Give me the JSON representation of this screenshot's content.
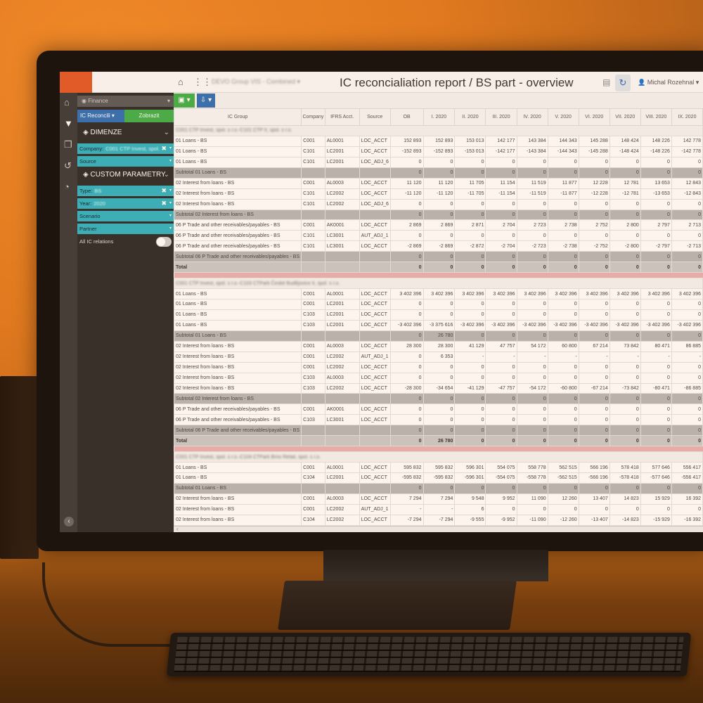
{
  "topbar": {
    "org_select": "DEVO Group VIS - Combined ▾",
    "title": "IC reconcialiation report / BS part - overview",
    "user": "Michal Rozehnal ▾",
    "home_icon": "home-icon",
    "apps_icon": "grid-icon"
  },
  "filters": {
    "module": "Finance",
    "report_button": "IC Reconcili ▾",
    "show_button": "Zobrazit",
    "dimenze_label": "DIMENZE",
    "company_label": "Company:",
    "company_value": "C001 CTP Invest, spol.",
    "source_label": "Source",
    "custom_label": "CUSTOM PARAMETRY",
    "type_label": "Type:",
    "type_value": "BS",
    "year_label": "Year:",
    "year_value": "2020",
    "scenario_label": "Scenario",
    "partner_label": "Partner",
    "all_ic_label": "All IC relations",
    "all_ic_on": false
  },
  "table": {
    "columns": [
      "IC Group",
      "Company",
      "IFRS Acct.",
      "Source",
      "OB",
      "I. 2020",
      "II. 2020",
      "III. 2020",
      "IV. 2020",
      "V. 2020",
      "VI. 2020",
      "VII. 2020",
      "VIII. 2020",
      "IX. 2020"
    ],
    "rows": [
      {
        "t": "grp",
        "label": "C001 CTP Invest, spol. s r.o.-C101 CTP II, spol. s r.o."
      },
      {
        "t": "d",
        "c": [
          "01 Loans - BS",
          "C001",
          "AL0001",
          "LOC_ACCT",
          "152 893",
          "152 893",
          "153 013",
          "142 177",
          "143 384",
          "144 343",
          "145 288",
          "148 424",
          "148 226",
          "142 778"
        ]
      },
      {
        "t": "d",
        "c": [
          "01 Loans - BS",
          "C101",
          "LC2001",
          "LOC_ACCT",
          "-152 893",
          "-152 893",
          "-153 013",
          "-142 177",
          "-143 384",
          "-144 343",
          "-145 288",
          "-148 424",
          "-148 226",
          "-142 778"
        ]
      },
      {
        "t": "d",
        "c": [
          "01 Loans - BS",
          "C101",
          "LC2001",
          "LOC_ADJ_6",
          "0",
          "0",
          "0",
          "0",
          "0",
          "0",
          "0",
          "0",
          "0",
          "0"
        ]
      },
      {
        "t": "sub",
        "c": [
          "Subtotal 01 Loans - BS",
          "",
          "",
          "",
          "0",
          "0",
          "0",
          "0",
          "0",
          "0",
          "0",
          "0",
          "0",
          "0"
        ]
      },
      {
        "t": "d",
        "c": [
          "02 Interest from loans - BS",
          "C001",
          "AL0003",
          "LOC_ACCT",
          "11 120",
          "11 120",
          "11 705",
          "11 154",
          "11 519",
          "11 877",
          "12 228",
          "12 781",
          "13 653",
          "12 843"
        ]
      },
      {
        "t": "d",
        "c": [
          "02 Interest from loans - BS",
          "C101",
          "LC2002",
          "LOC_ACCT",
          "-11 120",
          "-11 120",
          "-11 705",
          "-11 154",
          "-11 519",
          "-11 877",
          "-12 228",
          "-12 781",
          "-13 653",
          "-12 843"
        ]
      },
      {
        "t": "d",
        "c": [
          "02 Interest from loans - BS",
          "C101",
          "LC2002",
          "LOC_ADJ_6",
          "0",
          "0",
          "0",
          "0",
          "0",
          "0",
          "0",
          "0",
          "0",
          "0"
        ]
      },
      {
        "t": "sub",
        "c": [
          "Subtotal 02 Interest from loans - BS",
          "",
          "",
          "",
          "0",
          "0",
          "0",
          "0",
          "0",
          "0",
          "0",
          "0",
          "0",
          "0"
        ]
      },
      {
        "t": "d",
        "c": [
          "06 P Trade and other receivables/payables - BS",
          "C001",
          "AK0001",
          "LOC_ACCT",
          "2 869",
          "2 869",
          "2 871",
          "2 704",
          "2 723",
          "2 738",
          "2 752",
          "2 800",
          "2 797",
          "2 713"
        ]
      },
      {
        "t": "d",
        "c": [
          "06 P Trade and other receivables/payables - BS",
          "C101",
          "LC3001",
          "AUT_ADJ_1",
          "0",
          "0",
          "0",
          "0",
          "0",
          "0",
          "0",
          "0",
          "0",
          "0"
        ]
      },
      {
        "t": "d",
        "c": [
          "06 P Trade and other receivables/payables - BS",
          "C101",
          "LC3001",
          "LOC_ACCT",
          "-2 869",
          "-2 869",
          "-2 872",
          "-2 704",
          "-2 723",
          "-2 738",
          "-2 752",
          "-2 800",
          "-2 797",
          "-2 713"
        ]
      },
      {
        "t": "sub",
        "c": [
          "Subtotal 06 P Trade and other receivables/payables - BS",
          "",
          "",
          "",
          "0",
          "0",
          "0",
          "0",
          "0",
          "0",
          "0",
          "0",
          "0",
          "0"
        ]
      },
      {
        "t": "tot",
        "c": [
          "Total",
          "",
          "",
          "",
          "0",
          "0",
          "0",
          "0",
          "0",
          "0",
          "0",
          "0",
          "0",
          "0"
        ]
      },
      {
        "t": "sep"
      },
      {
        "t": "grp",
        "label": "C001 CTP Invest, spol. s r.o.-C103 CTPark České Budějovice II, spol. s r.o."
      },
      {
        "t": "d",
        "c": [
          "01 Loans - BS",
          "C001",
          "AL0001",
          "LOC_ACCT",
          "3 402 396",
          "3 402 396",
          "3 402 396",
          "3 402 396",
          "3 402 396",
          "3 402 396",
          "3 402 396",
          "3 402 396",
          "3 402 396",
          "3 402 396"
        ]
      },
      {
        "t": "d",
        "c": [
          "01 Loans - BS",
          "C001",
          "LC2001",
          "LOC_ACCT",
          "0",
          "0",
          "0",
          "0",
          "0",
          "0",
          "0",
          "0",
          "0",
          "0"
        ]
      },
      {
        "t": "d",
        "c": [
          "01 Loans - BS",
          "C103",
          "LC2001",
          "LOC_ACCT",
          "0",
          "0",
          "0",
          "0",
          "0",
          "0",
          "0",
          "0",
          "0",
          "0"
        ]
      },
      {
        "t": "d",
        "c": [
          "01 Loans - BS",
          "C103",
          "LC2001",
          "LOC_ACCT",
          "-3 402 396",
          "-3 375 616",
          "-3 402 396",
          "-3 402 396",
          "-3 402 396",
          "-3 402 396",
          "-3 402 396",
          "-3 402 396",
          "-3 402 396",
          "-3 402 396"
        ]
      },
      {
        "t": "sub",
        "c": [
          "Subtotal 01 Loans - BS",
          "",
          "",
          "",
          "0",
          "26 780",
          "0",
          "0",
          "0",
          "0",
          "0",
          "0",
          "0",
          "0"
        ]
      },
      {
        "t": "d",
        "c": [
          "02 Interest from loans - BS",
          "C001",
          "AL0003",
          "LOC_ACCT",
          "28 300",
          "28 300",
          "41 129",
          "47 757",
          "54 172",
          "60 800",
          "67 214",
          "73 842",
          "80 471",
          "86 885"
        ]
      },
      {
        "t": "d",
        "c": [
          "02 Interest from loans - BS",
          "C001",
          "LC2002",
          "AUT_ADJ_1",
          "0",
          "6 353",
          "-",
          "-",
          "-",
          "-",
          "-",
          "-",
          "-",
          "-"
        ]
      },
      {
        "t": "d",
        "c": [
          "02 Interest from loans - BS",
          "C001",
          "LC2002",
          "LOC_ACCT",
          "0",
          "0",
          "0",
          "0",
          "0",
          "0",
          "0",
          "0",
          "0",
          "0"
        ]
      },
      {
        "t": "d",
        "c": [
          "02 Interest from loans - BS",
          "C103",
          "AL0003",
          "LOC_ACCT",
          "0",
          "0",
          "0",
          "0",
          "0",
          "0",
          "0",
          "0",
          "0",
          "0"
        ]
      },
      {
        "t": "d",
        "c": [
          "02 Interest from loans - BS",
          "C103",
          "LC2002",
          "LOC_ACCT",
          "-28 300",
          "-34 654",
          "-41 129",
          "-47 757",
          "-54 172",
          "-60 800",
          "-67 214",
          "-73 842",
          "-80 471",
          "-86 885"
        ]
      },
      {
        "t": "sub",
        "c": [
          "Subtotal 02 Interest from loans - BS",
          "",
          "",
          "",
          "0",
          "0",
          "0",
          "0",
          "0",
          "0",
          "0",
          "0",
          "0",
          "0"
        ]
      },
      {
        "t": "d",
        "c": [
          "06 P Trade and other receivables/payables - BS",
          "C001",
          "AK0001",
          "LOC_ACCT",
          "0",
          "0",
          "0",
          "0",
          "0",
          "0",
          "0",
          "0",
          "0",
          "0"
        ]
      },
      {
        "t": "d",
        "c": [
          "06 P Trade and other receivables/payables - BS",
          "C103",
          "LC3001",
          "LOC_ACCT",
          "0",
          "0",
          "0",
          "0",
          "0",
          "0",
          "0",
          "0",
          "0",
          "0"
        ]
      },
      {
        "t": "sub",
        "c": [
          "Subtotal 06 P Trade and other receivables/payables - BS",
          "",
          "",
          "",
          "0",
          "0",
          "0",
          "0",
          "0",
          "0",
          "0",
          "0",
          "0",
          "0"
        ]
      },
      {
        "t": "tot",
        "c": [
          "Total",
          "",
          "",
          "",
          "0",
          "26 780",
          "0",
          "0",
          "0",
          "0",
          "0",
          "0",
          "0",
          "0"
        ]
      },
      {
        "t": "sep"
      },
      {
        "t": "grp",
        "label": "C001 CTP Invest, spol. s r.o.-C104 CTPark Brno Retail, spol. s r.o."
      },
      {
        "t": "d",
        "c": [
          "01 Loans - BS",
          "C001",
          "AL0001",
          "LOC_ACCT",
          "595 832",
          "595 832",
          "596 301",
          "554 075",
          "558 778",
          "562 515",
          "566 196",
          "578 418",
          "577 646",
          "556 417"
        ]
      },
      {
        "t": "d",
        "c": [
          "01 Loans - BS",
          "C104",
          "LC2001",
          "LOC_ACCT",
          "-595 832",
          "-595 832",
          "-596 301",
          "-554 075",
          "-558 778",
          "-562 515",
          "-566 196",
          "-578 418",
          "-577 646",
          "-556 417"
        ]
      },
      {
        "t": "sub",
        "c": [
          "Subtotal 01 Loans - BS",
          "",
          "",
          "",
          "0",
          "0",
          "0",
          "0",
          "0",
          "0",
          "0",
          "0",
          "0",
          "0"
        ]
      },
      {
        "t": "d",
        "c": [
          "02 Interest from loans - BS",
          "C001",
          "AL0003",
          "LOC_ACCT",
          "7 294",
          "7 294",
          "9 548",
          "9 952",
          "11 090",
          "12 260",
          "13 407",
          "14 823",
          "15 929",
          "16 392"
        ]
      },
      {
        "t": "d",
        "c": [
          "02 Interest from loans - BS",
          "C001",
          "LC2002",
          "AUT_ADJ_1",
          "-",
          "-",
          "6",
          "0",
          "0",
          "0",
          "0",
          "0",
          "0",
          "0"
        ]
      },
      {
        "t": "d",
        "c": [
          "02 Interest from loans - BS",
          "C104",
          "LC2002",
          "LOC_ACCT",
          "-7 294",
          "-7 294",
          "-9 555",
          "-9 952",
          "-11 090",
          "-12 260",
          "-13 407",
          "-14 823",
          "-15 929",
          "-16 392"
        ]
      }
    ]
  }
}
